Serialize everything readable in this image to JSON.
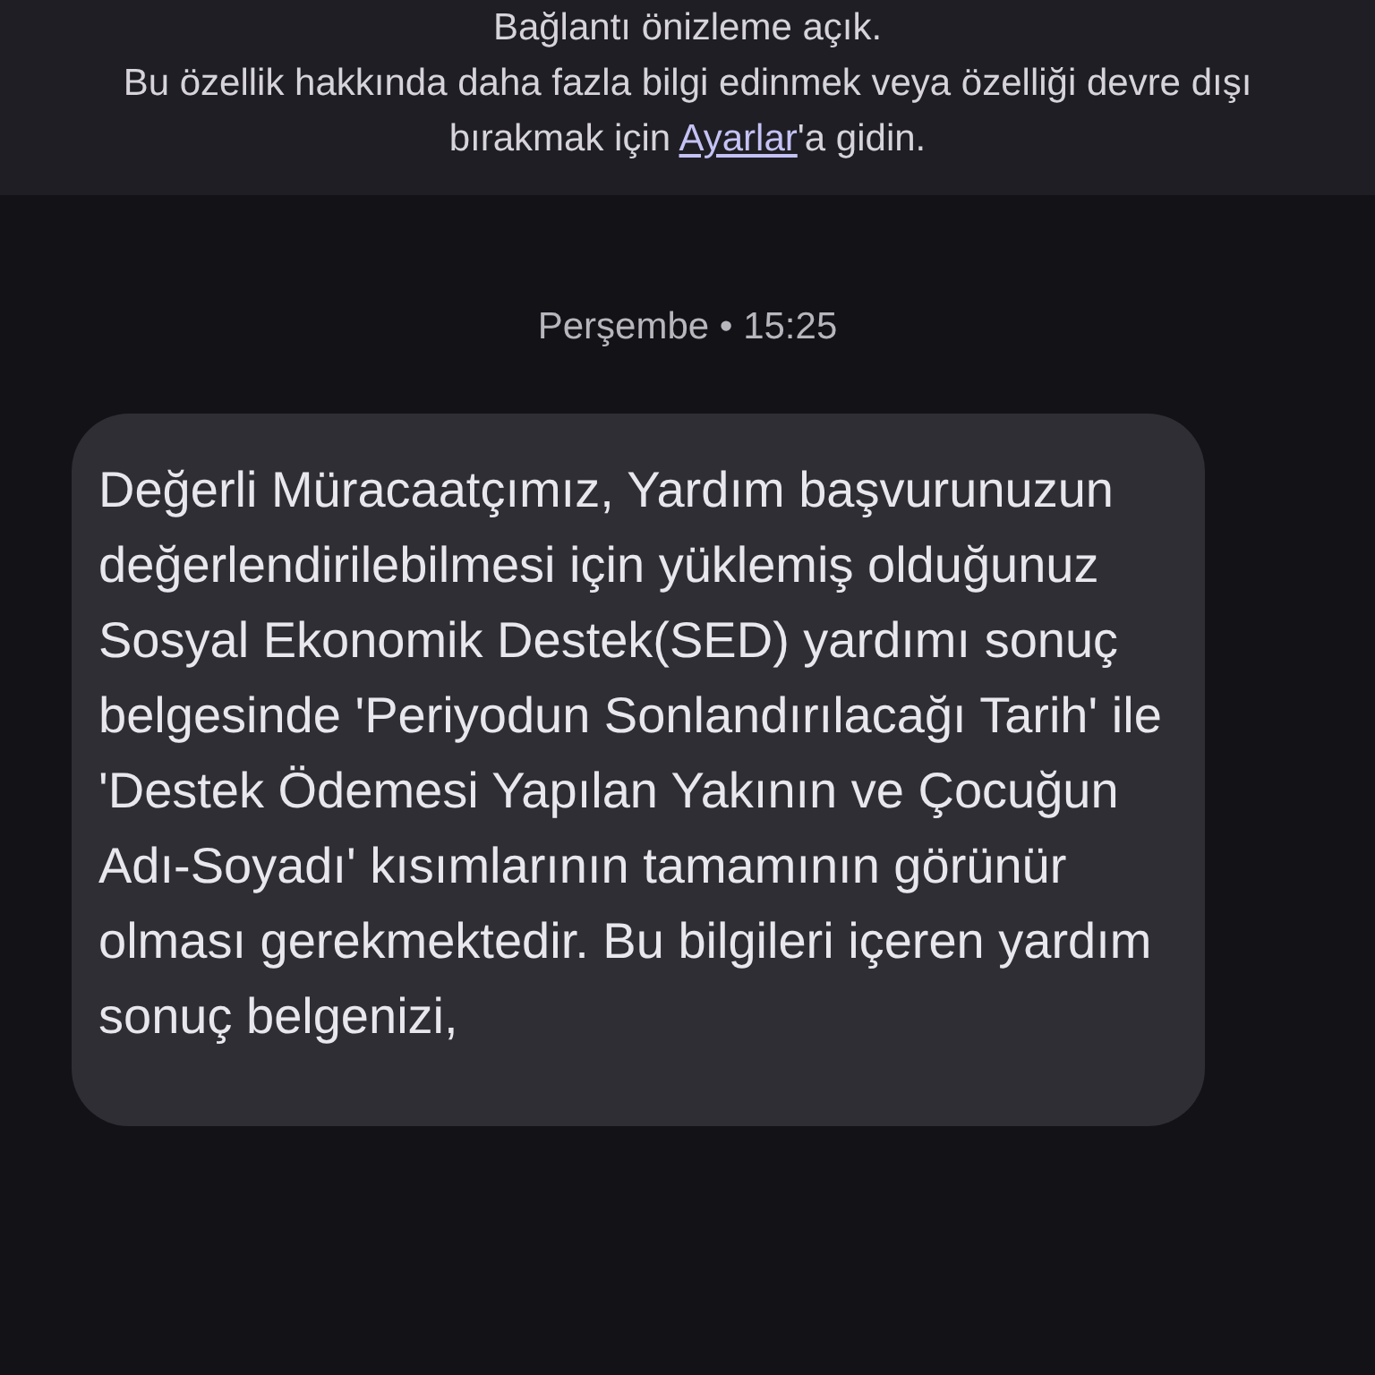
{
  "banner": {
    "title": "Bağlantı önizleme açık.",
    "text_before": "Bu özellik hakkında daha fazla bilgi edinmek veya özelliği devre dışı bırakmak için ",
    "link": "Ayarlar",
    "text_after": "'a gidin."
  },
  "timestamp": "Perşembe • 15:25",
  "message": {
    "text": "Değerli Müracaatçımız, Yardım başvurunuzun değerlendirilebilmesi için yüklemiş olduğunuz Sosyal Ekonomik Destek(SED) yardımı sonuç belgesinde 'Periyodun Sonlandırılacağı Tarih' ile 'Destek Ödemesi Yapılan Yakının ve Çocuğun Adı-Soyadı' kısımlarının tamamının görünür olması gerekmektedir. Bu bilgileri içeren yardım sonuç belgenizi,"
  }
}
